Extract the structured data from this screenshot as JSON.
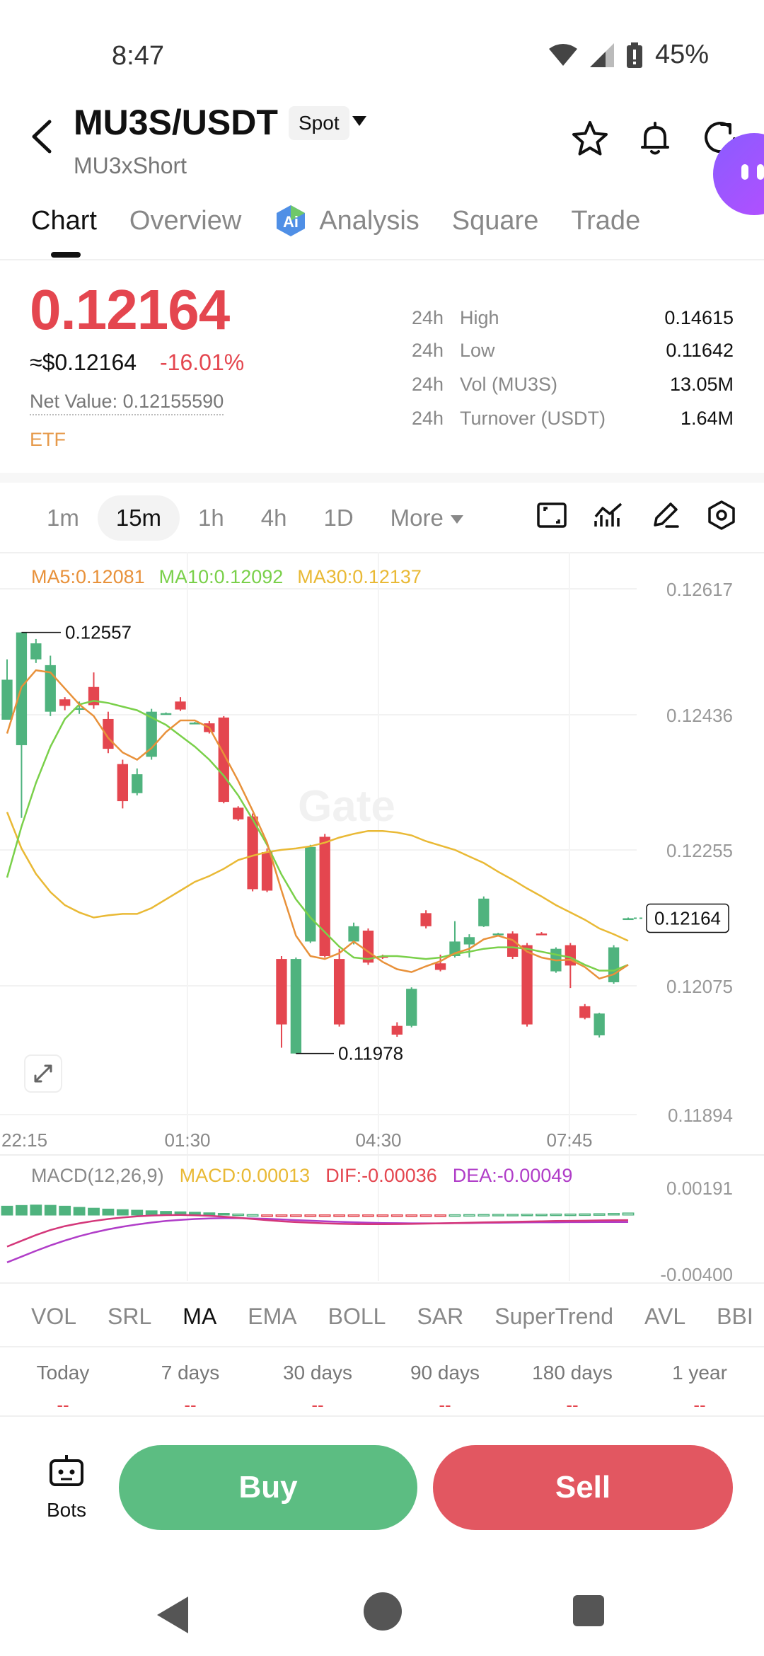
{
  "status": {
    "time": "8:47",
    "battery": "45%"
  },
  "header": {
    "pair": "MU3S/USDT",
    "market_tag": "Spot",
    "subname": "MU3xShort"
  },
  "tabs": [
    {
      "label": "Chart",
      "active": true
    },
    {
      "label": "Overview"
    },
    {
      "label": "Analysis",
      "icon": "ai-icon"
    },
    {
      "label": "Square"
    },
    {
      "label": "Trade"
    }
  ],
  "price": {
    "last": "0.12164",
    "usd": "≈$0.12164",
    "change": "-16.01%",
    "net_value": "Net Value: 0.12155590",
    "type": "ETF",
    "color_down": "#e4464f"
  },
  "stats": [
    {
      "prefix": "24h",
      "label": "High",
      "value": "0.14615"
    },
    {
      "prefix": "24h",
      "label": "Low",
      "value": "0.11642"
    },
    {
      "prefix": "24h",
      "label": "Vol (MU3S)",
      "value": "13.05M"
    },
    {
      "prefix": "24h",
      "label": "Turnover (USDT)",
      "value": "1.64M"
    }
  ],
  "timeframes": [
    {
      "label": "1m"
    },
    {
      "label": "15m",
      "active": true
    },
    {
      "label": "1h"
    },
    {
      "label": "4h"
    },
    {
      "label": "1D"
    },
    {
      "label": "More"
    }
  ],
  "ma_legend": {
    "ma5": "MA5:0.12081",
    "ma10": "MA10:0.12092",
    "ma30": "MA30:0.12137",
    "ma5_color": "#e8913a",
    "ma10_color": "#7ad04a",
    "ma30_color": "#e9b935"
  },
  "chart_data": {
    "type": "candlestick",
    "watermark": "Gate",
    "y_ticks": [
      "0.12617",
      "0.12436",
      "0.12255",
      "0.12075",
      "0.11894"
    ],
    "x_ticks": [
      "22:15",
      "01:30",
      "04:30",
      "07:45"
    ],
    "ylim": [
      0.11894,
      0.12617
    ],
    "high_label": "0.12557",
    "low_label": "0.11978",
    "last_price_label": "0.12164",
    "last_price": 0.12164,
    "up_color": "#4fb37e",
    "down_color": "#e4464f",
    "candles": [
      {
        "o": 0.12437,
        "c": 0.12492,
        "h": 0.1252,
        "l": 0.1244
      },
      {
        "o": 0.12402,
        "c": 0.12557,
        "h": 0.12557,
        "l": 0.12302
      },
      {
        "o": 0.1252,
        "c": 0.12542,
        "h": 0.12548,
        "l": 0.12515
      },
      {
        "o": 0.12448,
        "c": 0.12512,
        "h": 0.12525,
        "l": 0.12442
      },
      {
        "o": 0.12465,
        "c": 0.12456,
        "h": 0.12468,
        "l": 0.1245
      },
      {
        "o": 0.12453,
        "c": 0.12453,
        "h": 0.12462,
        "l": 0.12445
      },
      {
        "o": 0.12482,
        "c": 0.12457,
        "h": 0.12502,
        "l": 0.12452
      },
      {
        "o": 0.12438,
        "c": 0.12397,
        "h": 0.12448,
        "l": 0.12391
      },
      {
        "o": 0.12376,
        "c": 0.12325,
        "h": 0.12382,
        "l": 0.12315
      },
      {
        "o": 0.12336,
        "c": 0.12362,
        "h": 0.1237,
        "l": 0.12333
      },
      {
        "o": 0.12386,
        "c": 0.12448,
        "h": 0.12452,
        "l": 0.12382
      },
      {
        "o": 0.12446,
        "c": 0.12446,
        "h": 0.12447,
        "l": 0.12445
      },
      {
        "o": 0.12462,
        "c": 0.12451,
        "h": 0.12468,
        "l": 0.12449
      },
      {
        "o": 0.12433,
        "c": 0.12433,
        "h": 0.12434,
        "l": 0.12432
      },
      {
        "o": 0.12432,
        "c": 0.1242,
        "h": 0.12435,
        "l": 0.12418
      },
      {
        "o": 0.1244,
        "c": 0.12324,
        "h": 0.12442,
        "l": 0.12322
      },
      {
        "o": 0.12316,
        "c": 0.123,
        "h": 0.12318,
        "l": 0.12298
      },
      {
        "o": 0.12304,
        "c": 0.12204,
        "h": 0.12308,
        "l": 0.12201
      },
      {
        "o": 0.12255,
        "c": 0.12202,
        "h": 0.1226,
        "l": 0.122
      },
      {
        "o": 0.12108,
        "c": 0.12018,
        "h": 0.12112,
        "l": 0.11986
      },
      {
        "o": 0.11978,
        "c": 0.12108,
        "h": 0.1211,
        "l": 0.11978
      },
      {
        "o": 0.12132,
        "c": 0.12262,
        "h": 0.12265,
        "l": 0.1213
      },
      {
        "o": 0.12276,
        "c": 0.12112,
        "h": 0.1228,
        "l": 0.1211
      },
      {
        "o": 0.12108,
        "c": 0.12018,
        "h": 0.12122,
        "l": 0.12015
      },
      {
        "o": 0.12132,
        "c": 0.12153,
        "h": 0.12158,
        "l": 0.12128
      },
      {
        "o": 0.12147,
        "c": 0.12103,
        "h": 0.1215,
        "l": 0.121
      },
      {
        "o": 0.12112,
        "c": 0.1211,
        "h": 0.12114,
        "l": 0.12108
      },
      {
        "o": 0.12016,
        "c": 0.12004,
        "h": 0.12021,
        "l": 0.12001
      },
      {
        "o": 0.12016,
        "c": 0.12067,
        "h": 0.12069,
        "l": 0.12014
      },
      {
        "o": 0.12171,
        "c": 0.12153,
        "h": 0.12175,
        "l": 0.1215
      },
      {
        "o": 0.12102,
        "c": 0.12093,
        "h": 0.12114,
        "l": 0.12091
      },
      {
        "o": 0.12112,
        "c": 0.12132,
        "h": 0.1216,
        "l": 0.1211
      },
      {
        "o": 0.12128,
        "c": 0.12138,
        "h": 0.12142,
        "l": 0.1211
      },
      {
        "o": 0.12153,
        "c": 0.12191,
        "h": 0.12194,
        "l": 0.12152
      },
      {
        "o": 0.12143,
        "c": 0.12143,
        "h": 0.12144,
        "l": 0.12142
      },
      {
        "o": 0.12143,
        "c": 0.12111,
        "h": 0.12146,
        "l": 0.12108
      },
      {
        "o": 0.12127,
        "c": 0.12018,
        "h": 0.1213,
        "l": 0.12015
      },
      {
        "o": 0.12143,
        "c": 0.12142,
        "h": 0.12145,
        "l": 0.12141
      },
      {
        "o": 0.12091,
        "c": 0.12122,
        "h": 0.12124,
        "l": 0.12089
      },
      {
        "o": 0.12127,
        "c": 0.12099,
        "h": 0.1213,
        "l": 0.12068
      },
      {
        "o": 0.12043,
        "c": 0.12027,
        "h": 0.12046,
        "l": 0.12025
      },
      {
        "o": 0.12003,
        "c": 0.12033,
        "h": 0.12034,
        "l": 0.12
      },
      {
        "o": 0.12076,
        "c": 0.12124,
        "h": 0.12127,
        "l": 0.12074
      },
      {
        "o": 0.12164,
        "c": 0.12164,
        "h": 0.12165,
        "l": 0.12163
      }
    ],
    "ma5": [
      0.12418,
      0.12482,
      0.12505,
      0.12502,
      0.1248,
      0.12458,
      0.12442,
      0.12412,
      0.12392,
      0.12382,
      0.12398,
      0.1242,
      0.12436,
      0.12436,
      0.12426,
      0.1239,
      0.12353,
      0.12312,
      0.12268,
      0.12202,
      0.1214,
      0.12112,
      0.12108,
      0.12116,
      0.12132,
      0.12118,
      0.12104,
      0.12094,
      0.1209,
      0.12098,
      0.12105,
      0.12116,
      0.12122,
      0.12135,
      0.1214,
      0.12134,
      0.12118,
      0.1211,
      0.12106,
      0.12107,
      0.12097,
      0.12081,
      0.12087,
      0.121
    ],
    "ma10": [
      0.1222,
      0.1229,
      0.1235,
      0.124,
      0.12438,
      0.12458,
      0.12463,
      0.1246,
      0.12455,
      0.1245,
      0.1244,
      0.1243,
      0.12415,
      0.124,
      0.12382,
      0.1236,
      0.12333,
      0.123,
      0.12265,
      0.12224,
      0.1219,
      0.12165,
      0.12145,
      0.12125,
      0.1211,
      0.12108,
      0.12112,
      0.12112,
      0.1211,
      0.12108,
      0.1211,
      0.12115,
      0.12118,
      0.12122,
      0.12124,
      0.12124,
      0.12122,
      0.12118,
      0.12114,
      0.1211,
      0.121,
      0.12092,
      0.12092,
      0.121
    ],
    "ma30": [
      0.1231,
      0.1226,
      0.12225,
      0.122,
      0.12182,
      0.12172,
      0.12165,
      0.12168,
      0.1217,
      0.1217,
      0.12178,
      0.1219,
      0.12202,
      0.12214,
      0.12222,
      0.12232,
      0.12244,
      0.1225,
      0.12255,
      0.12258,
      0.1226,
      0.12263,
      0.12268,
      0.12275,
      0.1228,
      0.12284,
      0.12284,
      0.12282,
      0.12278,
      0.1227,
      0.12264,
      0.12258,
      0.12249,
      0.1224,
      0.12228,
      0.12217,
      0.12205,
      0.12194,
      0.12182,
      0.12172,
      0.12162,
      0.1215,
      0.12142,
      0.12133
    ]
  },
  "macd": {
    "legend": "MACD(12,26,9)",
    "macd": "MACD:0.00013",
    "dif": "DIF:-0.00036",
    "dea": "DEA:-0.00049",
    "macd_color": "#e9b935",
    "dif_color": "#e4464f",
    "dea_color": "#b03dc8",
    "y_ticks": [
      "0.00191",
      "-0.00400"
    ],
    "ylim": [
      -0.004,
      0.00191
    ],
    "hist": [
      0.0006,
      0.00065,
      0.00068,
      0.00066,
      0.0006,
      0.00052,
      0.00046,
      0.0004,
      0.00036,
      0.00032,
      0.00028,
      0.00024,
      0.00021,
      0.00018,
      0.00014,
      0.0001,
      6e-05,
      2e-05,
      -2e-05,
      -4e-05,
      -6e-05,
      -7e-05,
      -8e-05,
      -8e-05,
      -7e-05,
      -6e-05,
      -5e-05,
      -4e-05,
      -3e-05,
      -2e-05,
      -1e-05,
      1e-05,
      2e-05,
      3e-05,
      4e-05,
      4e-05,
      5e-05,
      5e-05,
      6e-05,
      6e-05,
      7e-05,
      8e-05,
      0.0001,
      0.00013
    ],
    "dif_line": [
      -0.0022,
      -0.0018,
      -0.0014,
      -0.00105,
      -0.00078,
      -0.00058,
      -0.00042,
      -0.00028,
      -0.00018,
      -0.0001,
      -4e-05,
      -1e-05,
      0.0,
      -2e-05,
      -6e-05,
      -0.00012,
      -0.0002,
      -0.00028,
      -0.00036,
      -0.00044,
      -0.0005,
      -0.00054,
      -0.00058,
      -0.00061,
      -0.00063,
      -0.00064,
      -0.00064,
      -0.00063,
      -0.00062,
      -0.0006,
      -0.00058,
      -0.00056,
      -0.00054,
      -0.00052,
      -0.0005,
      -0.00048,
      -0.00046,
      -0.00044,
      -0.00042,
      -0.00041,
      -0.0004,
      -0.00038,
      -0.00037,
      -0.00036
    ],
    "dea_line": [
      -0.0033,
      -0.0029,
      -0.0025,
      -0.00212,
      -0.00178,
      -0.00148,
      -0.00122,
      -0.001,
      -0.00082,
      -0.00066,
      -0.00053,
      -0.00042,
      -0.00034,
      -0.00028,
      -0.00024,
      -0.00022,
      -0.00022,
      -0.00024,
      -0.00027,
      -0.00031,
      -0.00036,
      -0.0004,
      -0.00044,
      -0.00048,
      -0.00051,
      -0.00054,
      -0.00056,
      -0.00057,
      -0.00058,
      -0.00058,
      -0.00058,
      -0.00057,
      -0.00056,
      -0.00055,
      -0.00054,
      -0.00053,
      -0.00052,
      -0.00051,
      -0.00051,
      -0.0005,
      -0.0005,
      -0.00049,
      -0.00049,
      -0.00049
    ]
  },
  "indicators": [
    {
      "label": "VOL"
    },
    {
      "label": "SRL"
    },
    {
      "label": "MA",
      "active": true
    },
    {
      "label": "EMA"
    },
    {
      "label": "BOLL"
    },
    {
      "label": "SAR"
    },
    {
      "label": "SuperTrend"
    },
    {
      "label": "AVL"
    },
    {
      "label": "BBI"
    }
  ],
  "periods": [
    {
      "label": "Today",
      "value": "--"
    },
    {
      "label": "7 days",
      "value": "--"
    },
    {
      "label": "30 days",
      "value": "--"
    },
    {
      "label": "90 days",
      "value": "--"
    },
    {
      "label": "180 days",
      "value": "--"
    },
    {
      "label": "1 year",
      "value": "--"
    }
  ],
  "bottom": {
    "bots_label": "Bots",
    "buy_label": "Buy",
    "sell_label": "Sell"
  }
}
